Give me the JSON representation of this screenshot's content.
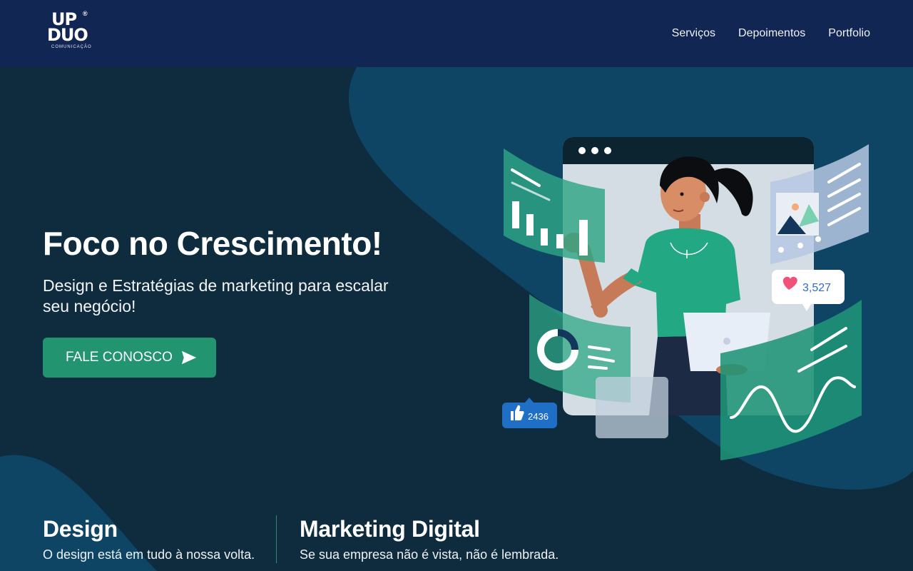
{
  "brand": {
    "logo_line1": "UP",
    "logo_line2": "DUO",
    "logo_sub": "COMUNICAÇÃO",
    "logo_reg": "®"
  },
  "nav": {
    "items": [
      {
        "label": "Serviços"
      },
      {
        "label": "Depoimentos"
      },
      {
        "label": "Portfolio"
      }
    ]
  },
  "hero": {
    "title": "Foco no Crescimento!",
    "subtitle": "Design e Estratégias de marketing para escalar seu negócio!",
    "cta_label": "FALE CONOSCO"
  },
  "illustration": {
    "likes_count": "3,527",
    "thumbs_count": "2436"
  },
  "features": [
    {
      "title": "Design",
      "text": "O design está em tudo à nossa volta."
    },
    {
      "title": "Marketing Digital",
      "text": "Se sua empresa não é vista, não é lembrada."
    }
  ],
  "colors": {
    "header_bg": "#112653",
    "page_bg": "#0f2b3e",
    "blob_bg": "#0e4564",
    "accent_green": "#229470",
    "badge_blue": "#1f6fc7",
    "heart_pink": "#f0527a"
  }
}
